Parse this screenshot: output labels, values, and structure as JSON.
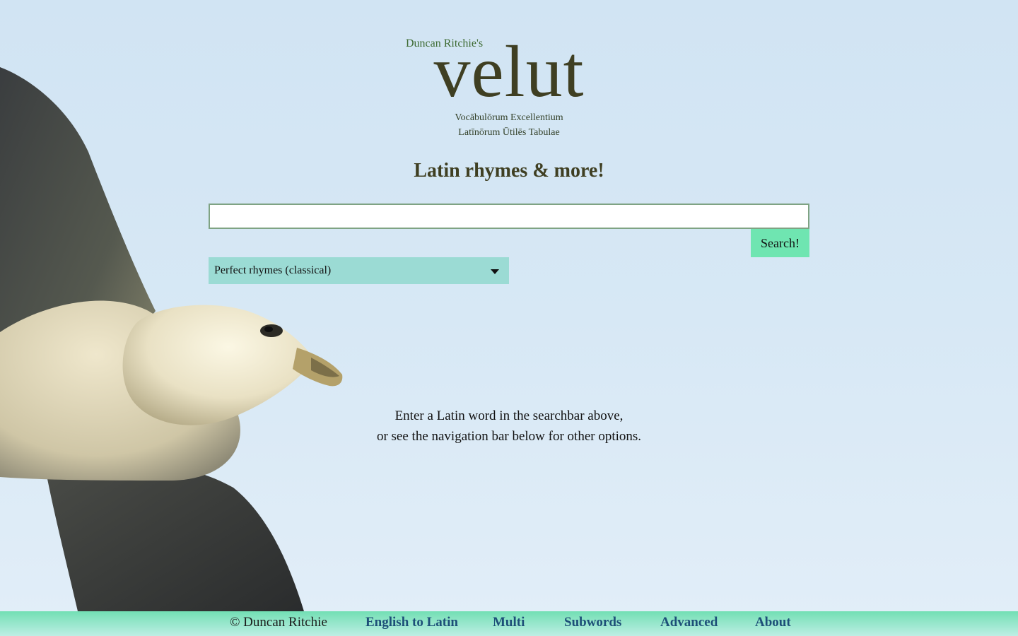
{
  "header": {
    "byline": "Duncan Ritchie's",
    "logo": "velut",
    "expansion_line1": "Vocābulōrum Excellentium",
    "expansion_line2": "Latīnōrum Ūtilēs Tabulae",
    "tagline": "Latin rhymes & more!"
  },
  "search": {
    "input_value": "",
    "button_label": "Search!",
    "mode_selected": "Perfect rhymes (classical)"
  },
  "info": {
    "line1": "Enter a Latin word in the searchbar above,",
    "line2": "or see the navigation bar below for other options."
  },
  "footer": {
    "copyright": "© Duncan Ritchie",
    "links": [
      {
        "label": "English to Latin"
      },
      {
        "label": "Multi"
      },
      {
        "label": "Subwords"
      },
      {
        "label": "Advanced"
      },
      {
        "label": "About"
      }
    ]
  },
  "colors": {
    "background": "#d1e4f3",
    "logo": "#3f3f22",
    "byline": "#3e6b33",
    "button": "#6fe5b1",
    "select": "#9bdbd4",
    "nav_link": "#1d4f78",
    "footer_top": "#73dfb4",
    "footer_bottom": "#bdeee4"
  },
  "decorative_image": "fulmar-bird-in-flight"
}
